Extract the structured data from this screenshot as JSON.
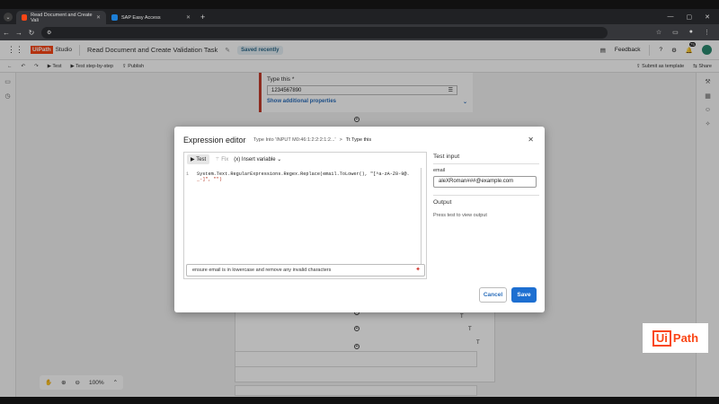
{
  "browser": {
    "tabs": [
      {
        "label": "Read Document and Create Vali",
        "active": true
      },
      {
        "label": "SAP Easy Access",
        "active": false
      }
    ],
    "new_tab": "+"
  },
  "app": {
    "logo_ui": "Ui",
    "logo_path": "Path",
    "logo_studio": "Studio",
    "project_title": "Read Document and Create Validation Task",
    "saved_status": "Saved recently",
    "feedback": "Feedback",
    "notif_count": "75"
  },
  "toolbar": {
    "test": "Test",
    "test_step": "Test step-by-step",
    "publish": "Publish",
    "submit_template": "Submit as template",
    "share": "Share"
  },
  "activity": {
    "label": "Type this *",
    "value": "1234567890",
    "more": "Show additional properties"
  },
  "dialog": {
    "title": "Expression editor",
    "breadcrumb": "Type Into 'INPUT M0:46:1:2:2:2:1:2...'",
    "breadcrumb_sep": ">",
    "breadcrumb_current": "Type this",
    "test_btn": "Test",
    "fix_btn": "Fix",
    "insert_var": "Insert variable",
    "code_line1_num": "1",
    "code_line1": "System.Text.RegularExpressions.Regex.Replace(email.ToLower(), \"[^a-zA-Z0-9@.",
    "code_line2": "_-]\", \"\")",
    "ai_prompt": "ensure email is in lowercase and remove any invalid characters",
    "test_input_heading": "Test input",
    "email_label": "email",
    "email_value": "aleXRoman###@example.com",
    "output_heading": "Output",
    "output_hint": "Press test to view output",
    "cancel": "Cancel",
    "save": "Save"
  },
  "bottom": {
    "zoom": "100%"
  },
  "watermark": {
    "ui": "Ui",
    "path": "Path"
  },
  "colors": {
    "brand": "#fa4616",
    "primary": "#1d6fd1",
    "activity_border": "#c43c2b"
  }
}
